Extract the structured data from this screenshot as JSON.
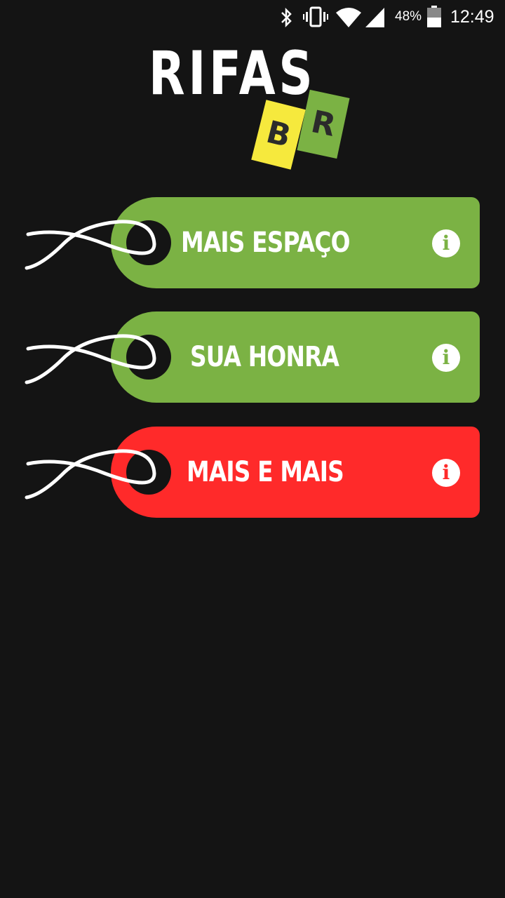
{
  "status_bar": {
    "battery_percent": "48%",
    "time": "12:49",
    "icons": [
      "bluetooth-icon",
      "vibrate-icon",
      "wifi-icon",
      "signal-icon",
      "battery-icon"
    ]
  },
  "logo": {
    "title": "RIFAS",
    "ticket_left": "B",
    "ticket_right": "R"
  },
  "raffles": [
    {
      "label": "MAIS ESPAÇO",
      "color": "#7bb244",
      "icon": "info-icon"
    },
    {
      "label": "SUA HONRA",
      "color": "#7bb244",
      "icon": "info-icon"
    },
    {
      "label": "MAIS E MAIS",
      "color": "#ff2a2a",
      "icon": "info-icon"
    }
  ],
  "colors": {
    "background": "#141414",
    "ticket_yellow": "#f6e93d",
    "ticket_green": "#7bb244"
  }
}
